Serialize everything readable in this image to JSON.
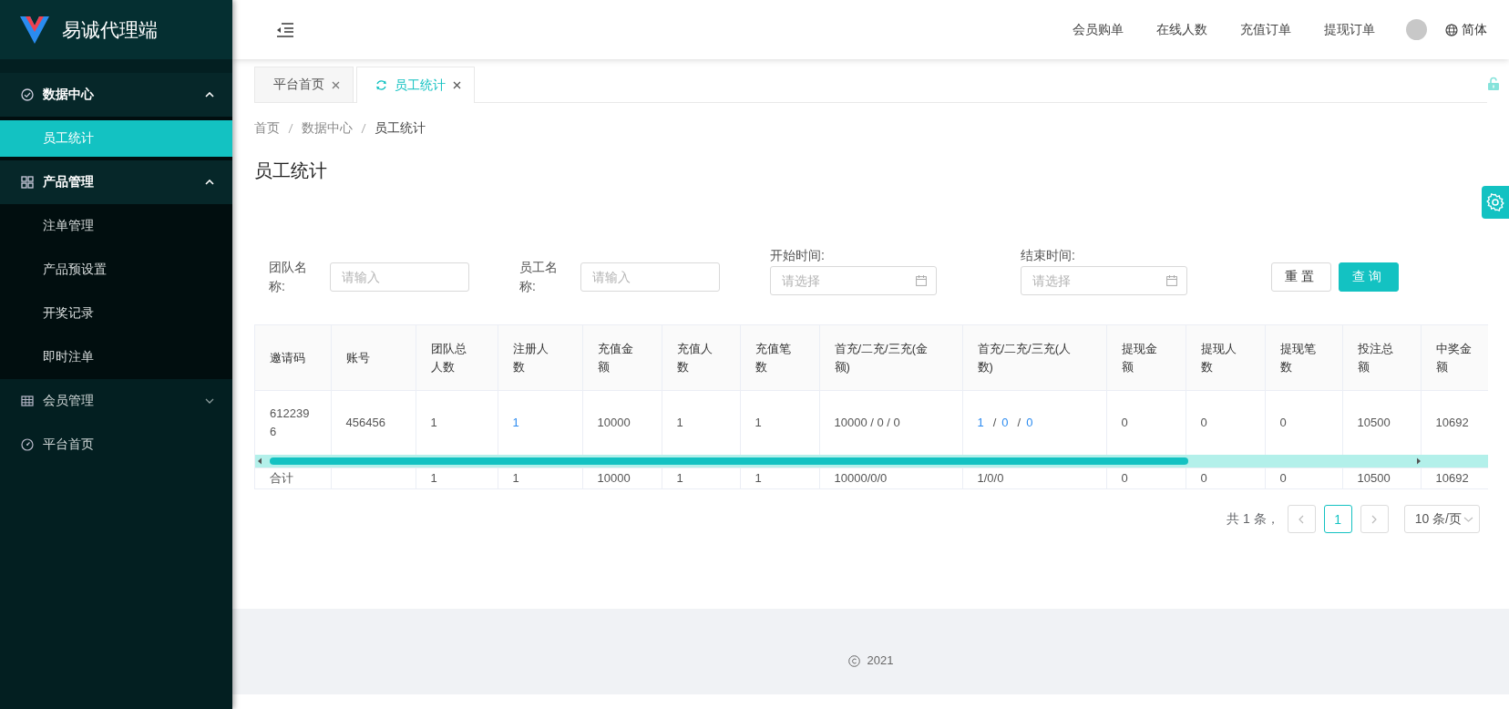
{
  "sidebar": {
    "logo_text": "易诚代理端",
    "items": [
      {
        "label": "数据中心",
        "kind": "group",
        "expanded": true,
        "children": [
          {
            "label": "员工统计",
            "selected": true
          }
        ]
      },
      {
        "label": "产品管理",
        "kind": "group",
        "expanded": true,
        "children": [
          {
            "label": "注单管理",
            "selected": false
          },
          {
            "label": "产品预设置",
            "selected": false
          },
          {
            "label": "开奖记录",
            "selected": false
          },
          {
            "label": "即时注单",
            "selected": false
          }
        ]
      },
      {
        "label": "会员管理",
        "kind": "group",
        "expanded": false
      },
      {
        "label": "平台首页",
        "kind": "link"
      }
    ]
  },
  "header": {
    "links": [
      "会员购单",
      "在线人数",
      "充值订单",
      "提现订单"
    ],
    "language": "简体"
  },
  "tabs": [
    {
      "label": "平台首页",
      "selected": false
    },
    {
      "label": "员工统计",
      "selected": true
    }
  ],
  "breadcrumb": [
    "首页",
    "数据中心",
    "员工统计"
  ],
  "page_title": "员工统计",
  "filters": [
    {
      "label": "团队名称:",
      "kind": "text",
      "placeholder": "请输入"
    },
    {
      "label": "员工名称:",
      "kind": "text",
      "placeholder": "请输入"
    },
    {
      "label": "开始时间:",
      "kind": "date",
      "placeholder": "请选择"
    },
    {
      "label": "结束时间:",
      "kind": "date",
      "placeholder": "请选择"
    }
  ],
  "buttons": [
    {
      "label": "重置",
      "kind": "default"
    },
    {
      "label": "查询",
      "kind": "primary"
    }
  ],
  "table": {
    "columns": [
      "邀请码",
      "账号",
      "团队总人数",
      "注册人数",
      "充值金额",
      "充值人数",
      "充值笔数",
      "首充/二充/三充(金额)",
      "首充/二充/三充(人数)",
      "提现金额",
      "提现人数",
      "提现笔数",
      "投注总额",
      "中奖金额"
    ],
    "rows": [
      [
        "6122396",
        "456456",
        "1",
        {
          "links": [
            "1"
          ]
        },
        "10000",
        "1",
        "1",
        "10000 / 0 / 0",
        {
          "links": [
            "1",
            "0",
            "0"
          ],
          "separator": "/"
        },
        "0",
        "0",
        "0",
        "10500",
        "10692"
      ]
    ],
    "summary": {
      "label": "合计",
      "values": [
        "1",
        "1",
        "10000",
        "1",
        "1",
        "10000/0/0",
        "1/0/0",
        "0",
        "0",
        "0",
        "10500",
        "10692"
      ]
    }
  },
  "pagination": {
    "total": "共 1 条，",
    "pages": [
      {
        "label": "1",
        "selected": true
      }
    ],
    "page_size": "10 条/页"
  },
  "footer": {
    "year": "2021"
  }
}
